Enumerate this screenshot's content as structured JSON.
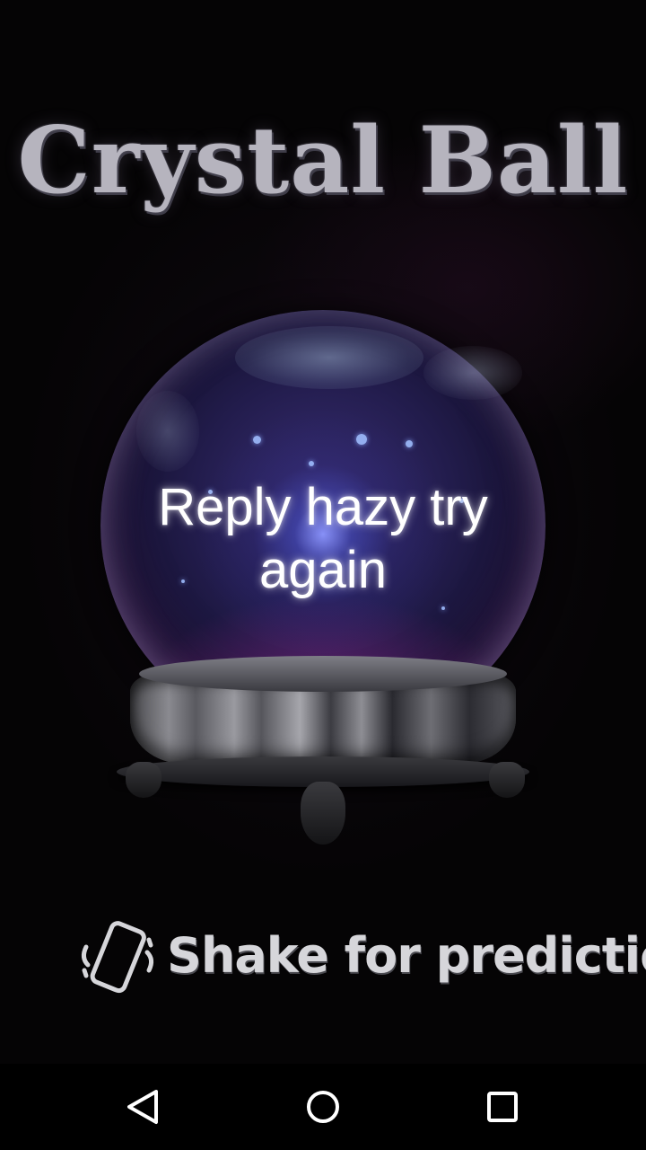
{
  "app": {
    "title": "Crystal Ball",
    "prediction": "Reply hazy try again",
    "hint": "Shake for prediction"
  },
  "icons": {
    "hint_icon": "phone-shake-icon",
    "nav": [
      "back-icon",
      "home-icon",
      "recents-icon"
    ]
  },
  "colors": {
    "background": "#050405",
    "title": "#b6b4be",
    "prediction": "#ffffff",
    "hint": "#d6d6da"
  }
}
